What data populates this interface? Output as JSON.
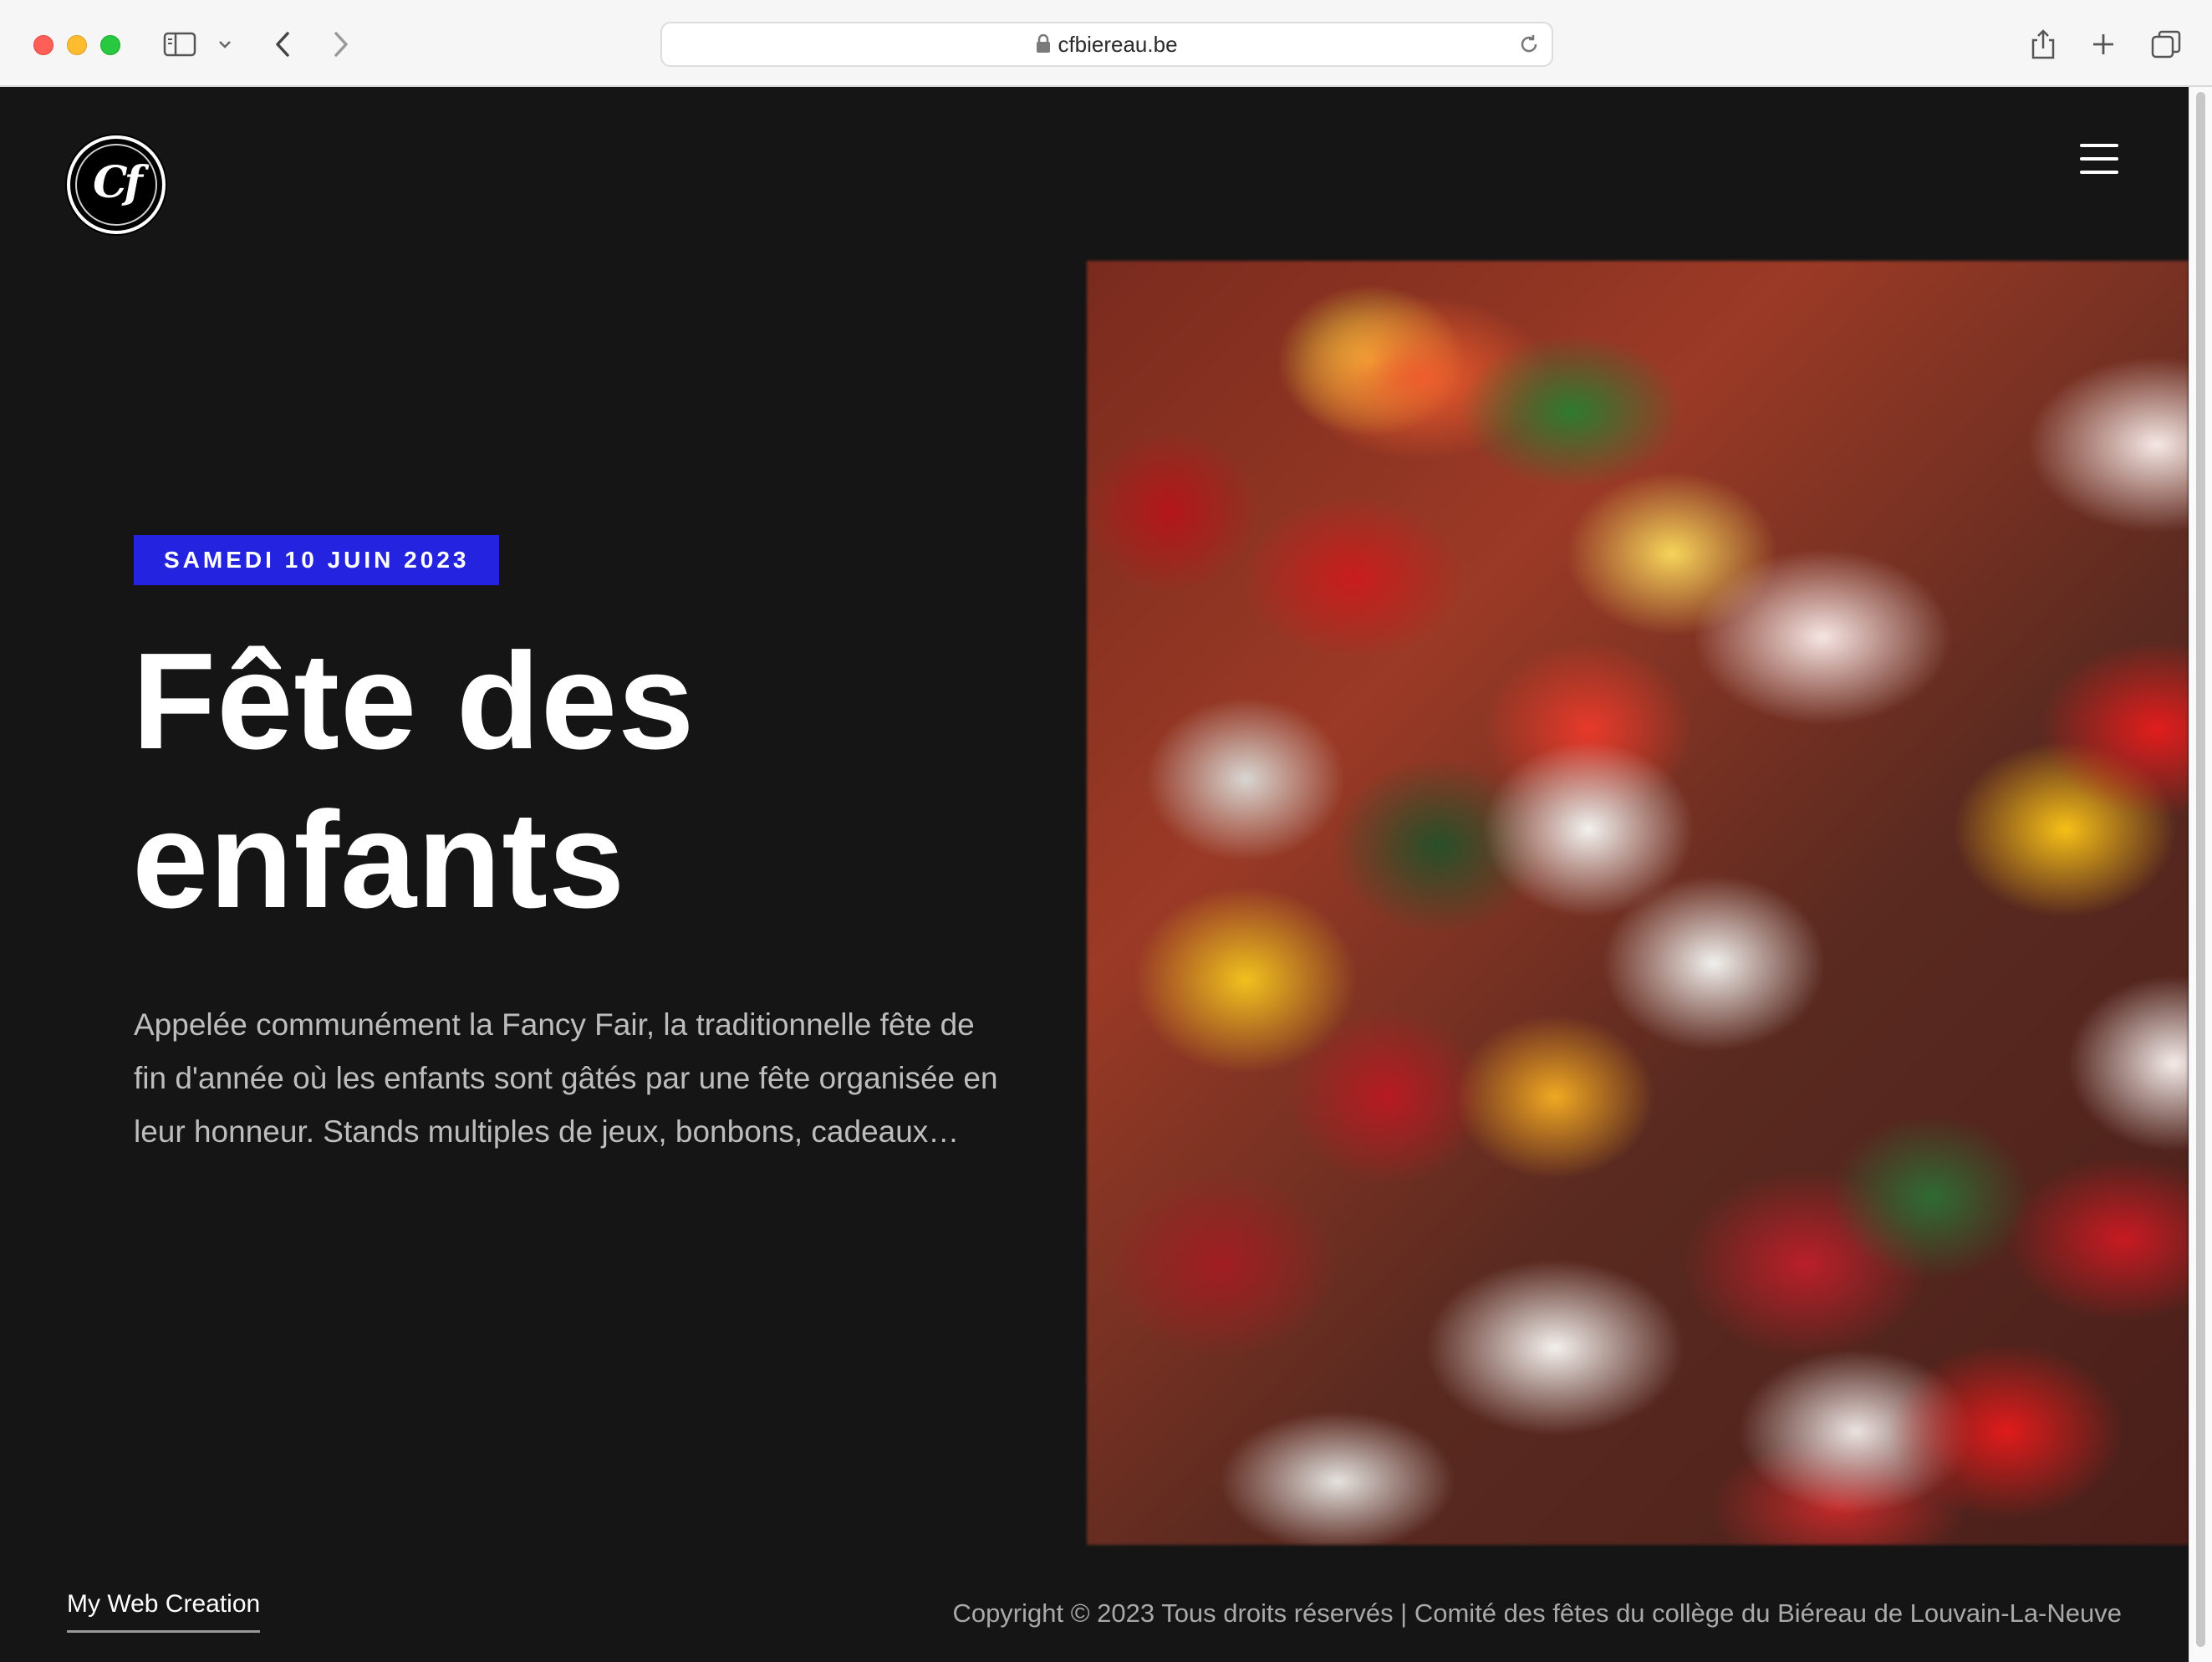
{
  "browser": {
    "url": "cfbiereau.be"
  },
  "header": {
    "logo_text": "Cf"
  },
  "hero": {
    "date_badge": "SAMEDI 10 JUIN 2023",
    "title_line1": "Fête des",
    "title_line2": "enfants",
    "description": "Appelée communément la Fancy Fair, la traditionnelle fête de fin d'année où les enfants sont gâtés par une fête organisée en leur honneur. Stands multiples de jeux, bonbons, cadeaux…",
    "image": "colorful-gummy-candies-photo"
  },
  "footer": {
    "credit": "My Web Creation",
    "copyright": "Copyright © 2023 Tous droits réservés | Comité des fêtes du collège du Biéreau de Louvain-La-Neuve"
  },
  "colors": {
    "background": "#151515",
    "badge": "#2424e0",
    "text": "#ffffff",
    "muted_text": "#bdbdbd"
  }
}
